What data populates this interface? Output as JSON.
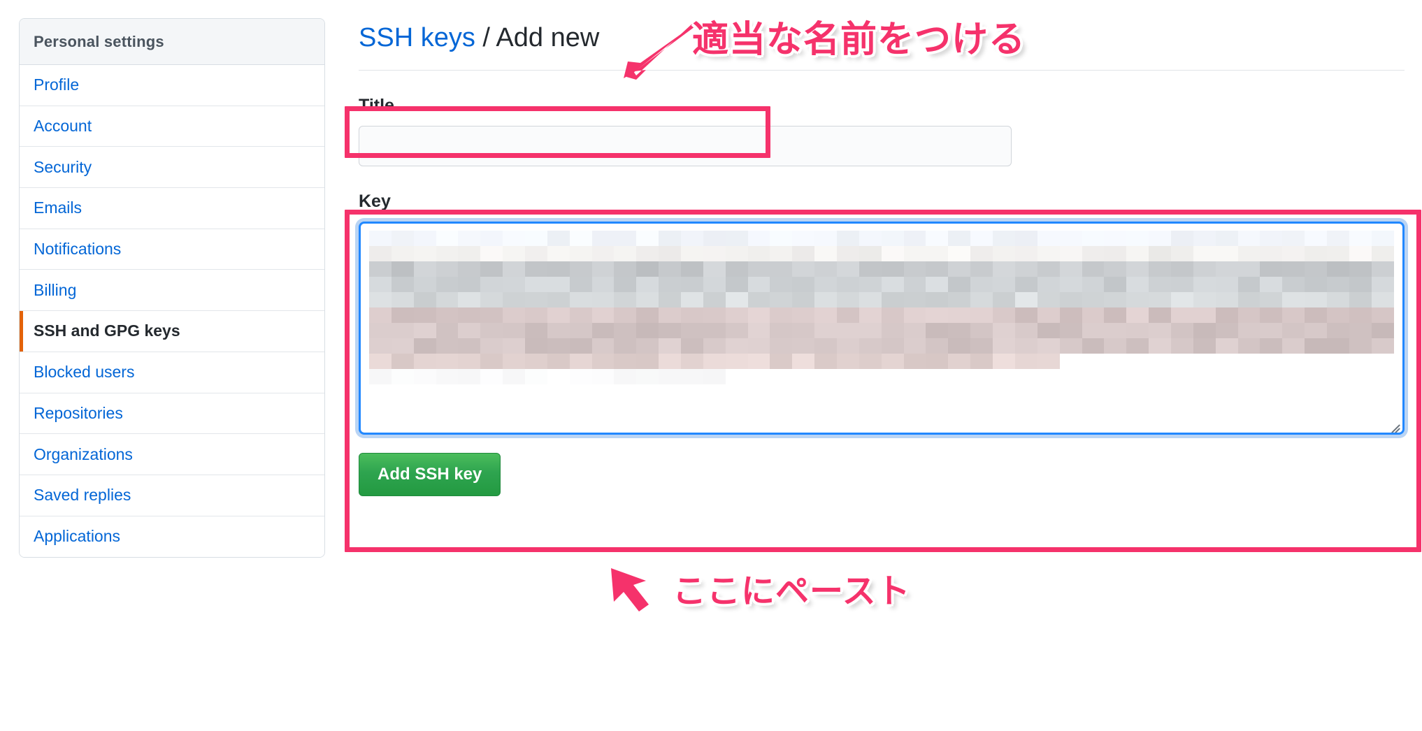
{
  "sidebar": {
    "header": "Personal settings",
    "items": [
      {
        "label": "Profile",
        "active": false
      },
      {
        "label": "Account",
        "active": false
      },
      {
        "label": "Security",
        "active": false
      },
      {
        "label": "Emails",
        "active": false
      },
      {
        "label": "Notifications",
        "active": false
      },
      {
        "label": "Billing",
        "active": false
      },
      {
        "label": "SSH and GPG keys",
        "active": true
      },
      {
        "label": "Blocked users",
        "active": false
      },
      {
        "label": "Repositories",
        "active": false
      },
      {
        "label": "Organizations",
        "active": false
      },
      {
        "label": "Saved replies",
        "active": false
      },
      {
        "label": "Applications",
        "active": false
      }
    ]
  },
  "header": {
    "title_link": "SSH keys",
    "title_separator": " / ",
    "title_current": "Add new"
  },
  "form": {
    "title_label": "Title",
    "title_value": "",
    "title_placeholder": "",
    "key_label": "Key",
    "key_value": "",
    "key_placeholder": "",
    "key_redacted": true,
    "submit_label": "Add SSH key"
  },
  "annotations": [
    {
      "id": "title-callout",
      "text": "適当な名前をつける",
      "arrow": "down-left",
      "color": "#f5326b"
    },
    {
      "id": "key-callout",
      "text": "ここにペースト",
      "arrow": "up-left",
      "color": "#f5326b"
    }
  ],
  "colors": {
    "annotation_pink": "#f5326b",
    "link_blue": "#0366d6",
    "active_marker_orange": "#e36209",
    "button_green": "#2ea44f",
    "focus_blue": "#2188ff"
  }
}
